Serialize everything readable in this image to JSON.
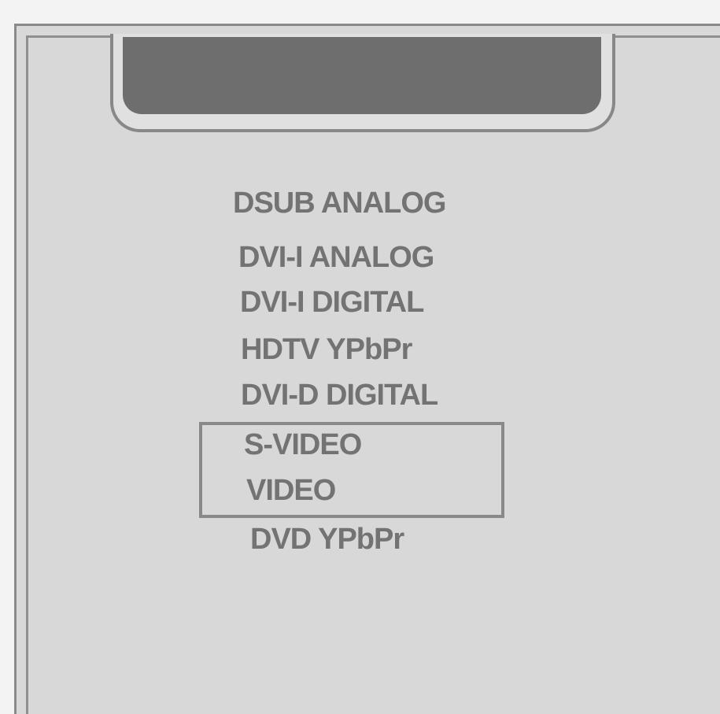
{
  "input_menu": {
    "items": [
      {
        "label": "DSUB ANALOG"
      },
      {
        "label": "DVI-I ANALOG"
      },
      {
        "label": "DVI-I DIGITAL"
      },
      {
        "label": "HDTV YPbPr"
      },
      {
        "label": "DVI-D DIGITAL"
      },
      {
        "label": "S-VIDEO"
      },
      {
        "label": "VIDEO"
      },
      {
        "label": "DVD YPbPr"
      }
    ],
    "highlighted_items": [
      "S-VIDEO",
      "VIDEO"
    ]
  },
  "colors": {
    "panel_background": "#d8d8d8",
    "display_screen": "#6e6e6e",
    "menu_text": "#737373",
    "selection_border": "#898989"
  }
}
